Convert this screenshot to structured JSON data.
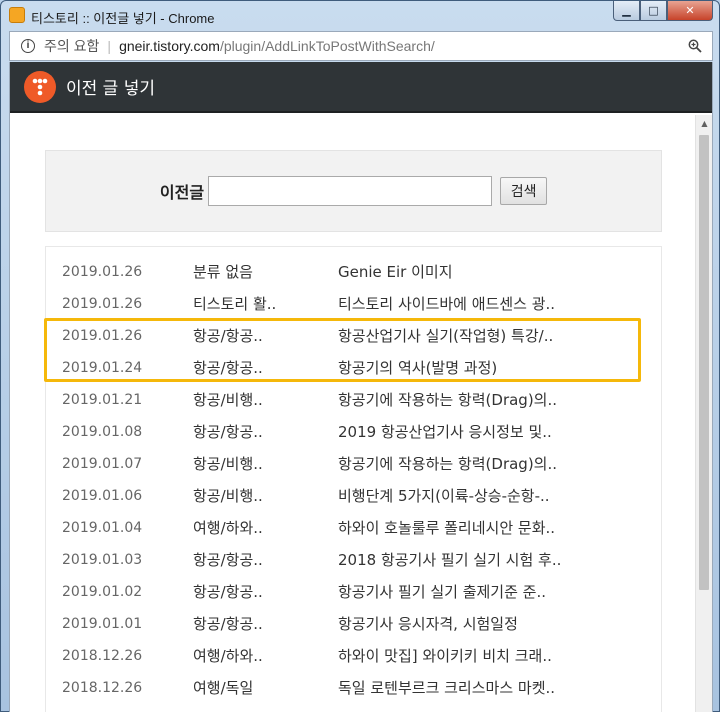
{
  "window": {
    "title": "티스토리 :: 이전글 넣기 - Chrome",
    "app_icon_glyph": "⬚",
    "minimize_label": "▁",
    "maximize_label": "□",
    "close_label": "✕"
  },
  "address": {
    "insecure_label": "주의 요함",
    "host": "gneir.tistory.com",
    "path": "/plugin/AddLinkToPostWithSearch/"
  },
  "header": {
    "title": "이전 글 넣기"
  },
  "search": {
    "label": "이전글",
    "value": "",
    "button_label": "검색"
  },
  "posts": [
    {
      "date": "2019.01.26",
      "category": "분류 없음",
      "title": "Genie Eir 이미지"
    },
    {
      "date": "2019.01.26",
      "category": "티스토리 활..",
      "title": "티스토리 사이드바에 애드센스 광.."
    },
    {
      "date": "2019.01.26",
      "category": "항공/항공..",
      "title": "항공산업기사 실기(작업형) 특강/.."
    },
    {
      "date": "2019.01.24",
      "category": "항공/항공..",
      "title": "항공기의 역사(발명 과정)"
    },
    {
      "date": "2019.01.21",
      "category": "항공/비행..",
      "title": "항공기에 작용하는 항력(Drag)의.."
    },
    {
      "date": "2019.01.08",
      "category": "항공/항공..",
      "title": "2019 항공산업기사 응시정보 및.."
    },
    {
      "date": "2019.01.07",
      "category": "항공/비행..",
      "title": "항공기에 작용하는 항력(Drag)의.."
    },
    {
      "date": "2019.01.06",
      "category": "항공/비행..",
      "title": "비행단계 5가지(이륙-상승-순항-.."
    },
    {
      "date": "2019.01.04",
      "category": "여행/하와..",
      "title": "하와이 호놀룰루 폴리네시안 문화.."
    },
    {
      "date": "2019.01.03",
      "category": "항공/항공..",
      "title": "2018 항공기사 필기 실기 시험 후.."
    },
    {
      "date": "2019.01.02",
      "category": "항공/항공..",
      "title": "항공기사 필기 실기 출제기준 준.."
    },
    {
      "date": "2019.01.01",
      "category": "항공/항공..",
      "title": "항공기사 응시자격, 시험일정"
    },
    {
      "date": "2018.12.26",
      "category": "여행/하와..",
      "title": "하와이 맛집] 와이키키 비치 크래.."
    },
    {
      "date": "2018.12.26",
      "category": "여행/독일",
      "title": "독일 로텐부르크 크리스마스 마켓.."
    }
  ],
  "colors": {
    "highlight": "#f5b80a",
    "header_bg": "#2f3437",
    "logo": "#ef5a28"
  }
}
